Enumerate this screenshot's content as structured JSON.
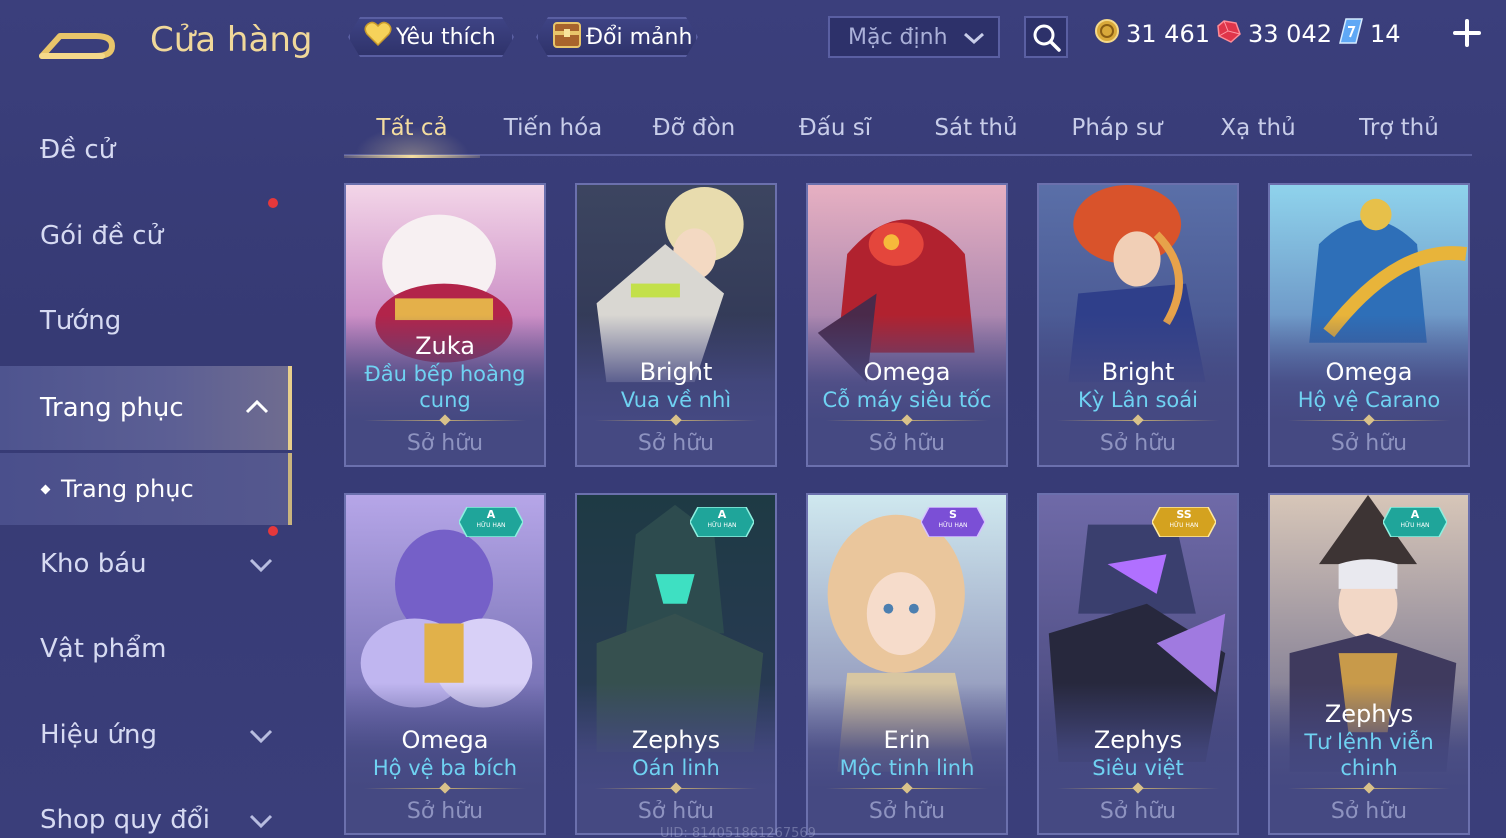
{
  "header": {
    "title": "Cửa hàng",
    "favorites_label": "Yêu thích",
    "shards_label": "Đổi mảnh",
    "sort_value": "Mặc định"
  },
  "currency": {
    "gold": "31 461",
    "ruby": "33 042",
    "voucher": "14"
  },
  "sidebar": {
    "items": [
      {
        "label": "Đề cử"
      },
      {
        "label": "Gói đề cử"
      },
      {
        "label": "Tướng"
      },
      {
        "label": "Trang phục"
      },
      {
        "label": "Kho báu"
      },
      {
        "label": "Vật phẩm"
      },
      {
        "label": "Hiệu ứng"
      },
      {
        "label": "Shop quy đổi"
      }
    ],
    "sub_item": "Trang phục"
  },
  "tabs": [
    "Tất cả",
    "Tiến hóa",
    "Đỡ đòn",
    "Đấu sĩ",
    "Sát thủ",
    "Pháp sư",
    "Xạ thủ",
    "Trợ thủ"
  ],
  "active_tab": "Tất cả",
  "cards": [
    {
      "hero": "Zuka",
      "skin": "Đầu bếp hoàng cung",
      "status": "Sở hữu"
    },
    {
      "hero": "Bright",
      "skin": "Vua về nhì",
      "status": "Sở hữu"
    },
    {
      "hero": "Omega",
      "skin": "Cỗ máy siêu tốc",
      "status": "Sở hữu"
    },
    {
      "hero": "Bright",
      "skin": "Kỳ Lân soái",
      "status": "Sở hữu"
    },
    {
      "hero": "Omega",
      "skin": "Hộ vệ Carano",
      "status": "Sở hữu"
    },
    {
      "hero": "Omega",
      "skin": "Hộ vệ ba bích",
      "status": "Sở hữu",
      "badge": "A",
      "badge_sub": "HỮU HẠN"
    },
    {
      "hero": "Zephys",
      "skin": "Oán linh",
      "status": "Sở hữu",
      "badge": "A",
      "badge_sub": "HỮU HẠN"
    },
    {
      "hero": "Erin",
      "skin": "Mộc tinh linh",
      "status": "Sở hữu",
      "badge": "S",
      "badge_sub": "HỮU HẠN"
    },
    {
      "hero": "Zephys",
      "skin": "Siêu việt",
      "status": "Sở hữu",
      "badge": "SS",
      "badge_sub": "HỮU HẠN"
    },
    {
      "hero": "Zephys",
      "skin": "Tư lệnh viễn chinh",
      "status": "Sở hữu",
      "badge": "A",
      "badge_sub": "HỮU HẠN"
    }
  ],
  "footer": {
    "uid": "UID: 814051861267569"
  },
  "colors": {
    "accent_gold": "#f0d89a",
    "skin_name": "#6fd2f2",
    "background": "#3b3f7c",
    "badge_a": "#1fa59a",
    "badge_s": "#7b4fd6",
    "badge_ss": "#d4a21f",
    "notification_dot": "#e5383b"
  },
  "icons": [
    "back-arrow-icon",
    "heart-icon",
    "chest-icon",
    "chevron-down-icon",
    "search-icon",
    "gold-coin-icon",
    "ruby-icon",
    "voucher-icon",
    "plus-icon",
    "chevron-up-icon"
  ]
}
